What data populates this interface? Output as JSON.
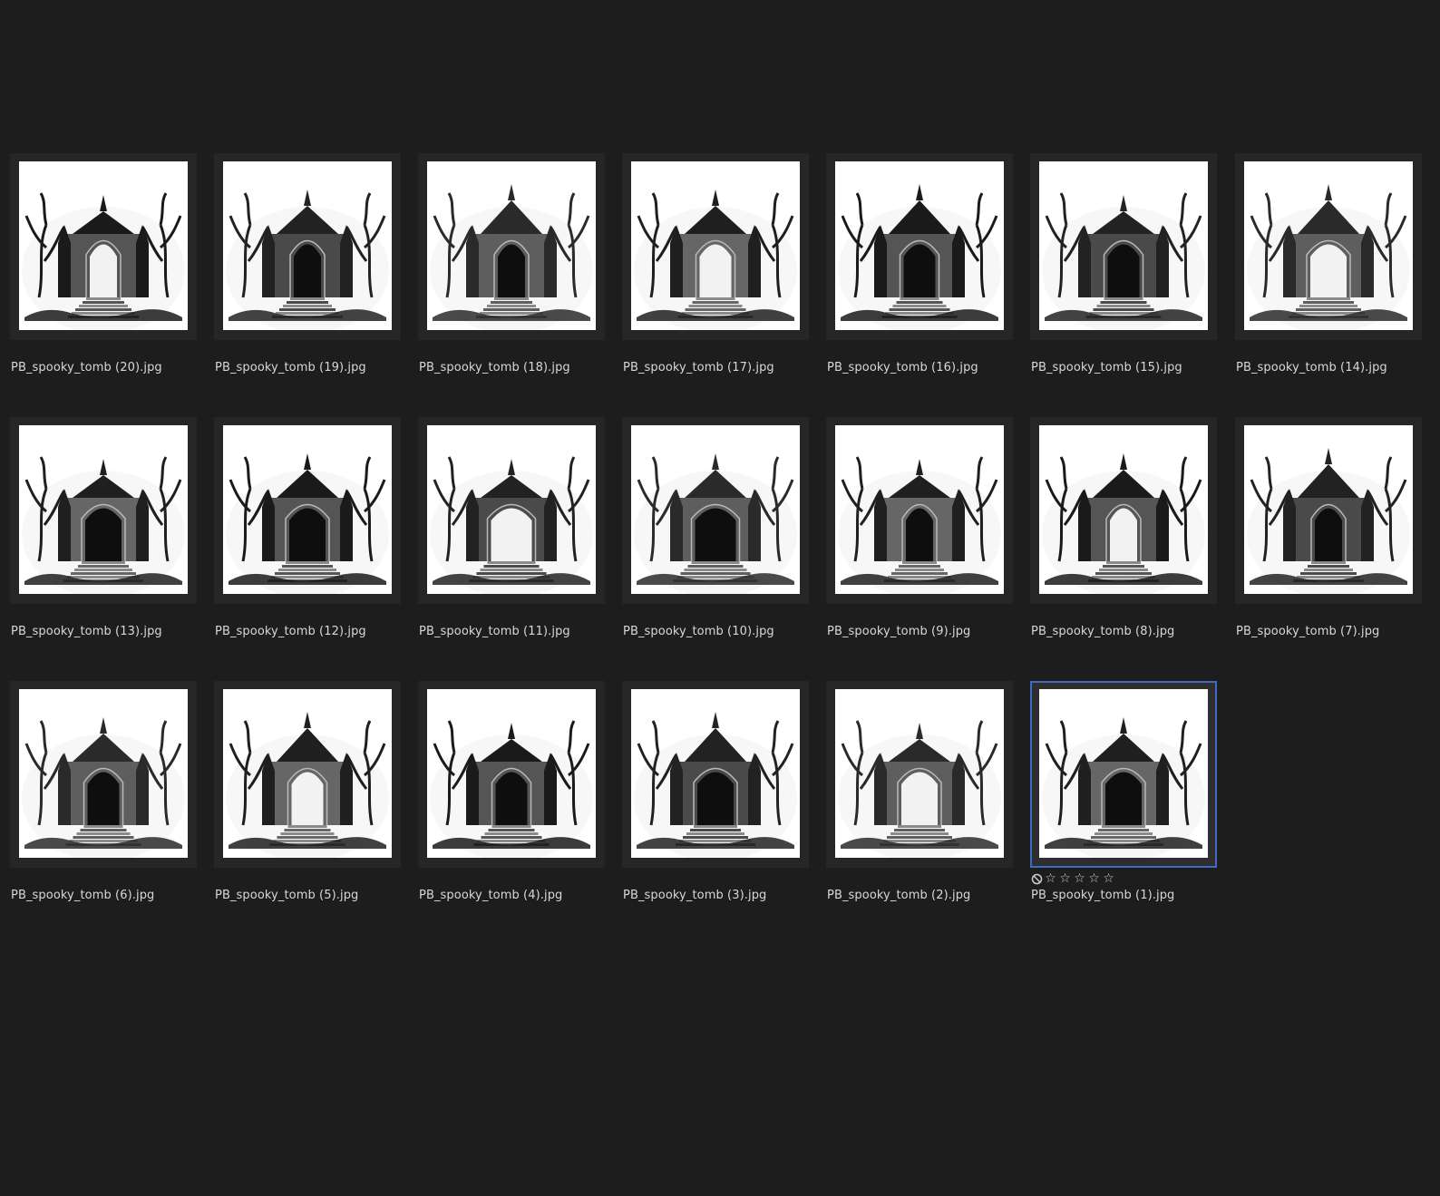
{
  "colors": {
    "background": "#1d1d1d",
    "cell_background": "#262626",
    "selection_border": "#3d6bc4",
    "caption_text": "#d8d8d8"
  },
  "thumbnails": [
    {
      "filename": "PB_spooky_tomb (20).jpg",
      "selected": false
    },
    {
      "filename": "PB_spooky_tomb (19).jpg",
      "selected": false
    },
    {
      "filename": "PB_spooky_tomb (18).jpg",
      "selected": false
    },
    {
      "filename": "PB_spooky_tomb (17).jpg",
      "selected": false
    },
    {
      "filename": "PB_spooky_tomb (16).jpg",
      "selected": false
    },
    {
      "filename": "PB_spooky_tomb (15).jpg",
      "selected": false
    },
    {
      "filename": "PB_spooky_tomb (14).jpg",
      "selected": false
    },
    {
      "filename": "PB_spooky_tomb (13).jpg",
      "selected": false
    },
    {
      "filename": "PB_spooky_tomb (12).jpg",
      "selected": false
    },
    {
      "filename": "PB_spooky_tomb (11).jpg",
      "selected": false
    },
    {
      "filename": "PB_spooky_tomb (10).jpg",
      "selected": false
    },
    {
      "filename": "PB_spooky_tomb (9).jpg",
      "selected": false
    },
    {
      "filename": "PB_spooky_tomb (8).jpg",
      "selected": false
    },
    {
      "filename": "PB_spooky_tomb (7).jpg",
      "selected": false
    },
    {
      "filename": "PB_spooky_tomb (6).jpg",
      "selected": false
    },
    {
      "filename": "PB_spooky_tomb (5).jpg",
      "selected": false
    },
    {
      "filename": "PB_spooky_tomb (4).jpg",
      "selected": false
    },
    {
      "filename": "PB_spooky_tomb (3).jpg",
      "selected": false
    },
    {
      "filename": "PB_spooky_tomb (2).jpg",
      "selected": false
    },
    {
      "filename": "PB_spooky_tomb (1).jpg",
      "selected": true,
      "rating": {
        "reject_icon": "reject-icon",
        "stars": 0,
        "max_stars": 5,
        "star_glyph": "☆"
      }
    }
  ]
}
